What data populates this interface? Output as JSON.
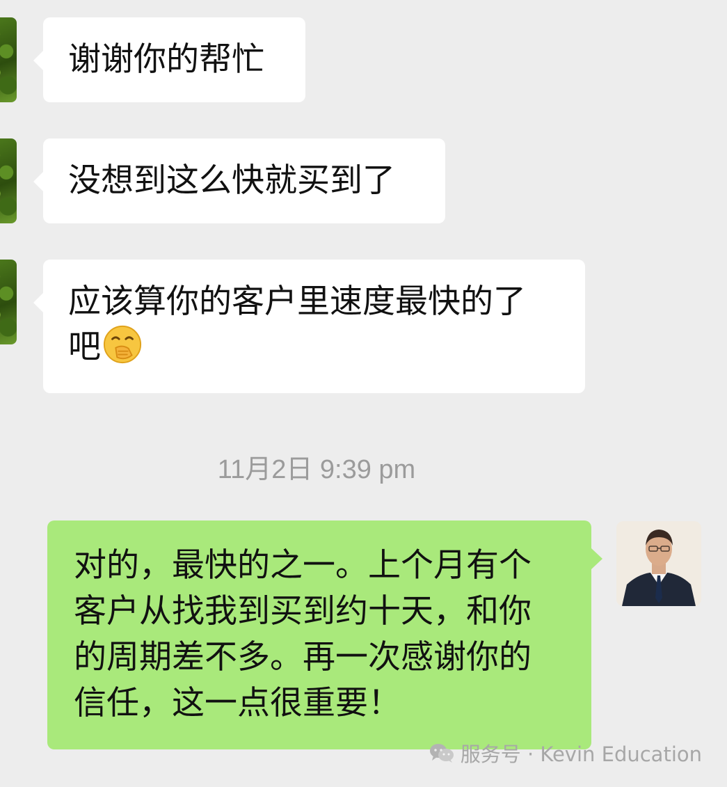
{
  "messages": [
    {
      "side": "incoming",
      "text": "谢谢你的帮忙"
    },
    {
      "side": "incoming",
      "text": "没想到这么快就买到了"
    },
    {
      "side": "incoming",
      "text": "应该算你的客户里速度最快的了\n吧",
      "emoji": "hand-over-mouth-emoji"
    },
    {
      "side": "outgoing",
      "text": "对的，最快的之一。上个月有个\n客户从找我到买到约十天，和你\n的周期差不多。再一次感谢你的\n信任，这一点很重要！"
    }
  ],
  "timestamp": "11月2日 9:39 pm",
  "watermark": {
    "text": "服务号 · Kevin Education",
    "icon": "wechat-icon"
  },
  "colors": {
    "background": "#ededed",
    "incoming_bubble": "#ffffff",
    "outgoing_bubble": "#a9e97b",
    "timestamp": "#9b9b9b"
  }
}
